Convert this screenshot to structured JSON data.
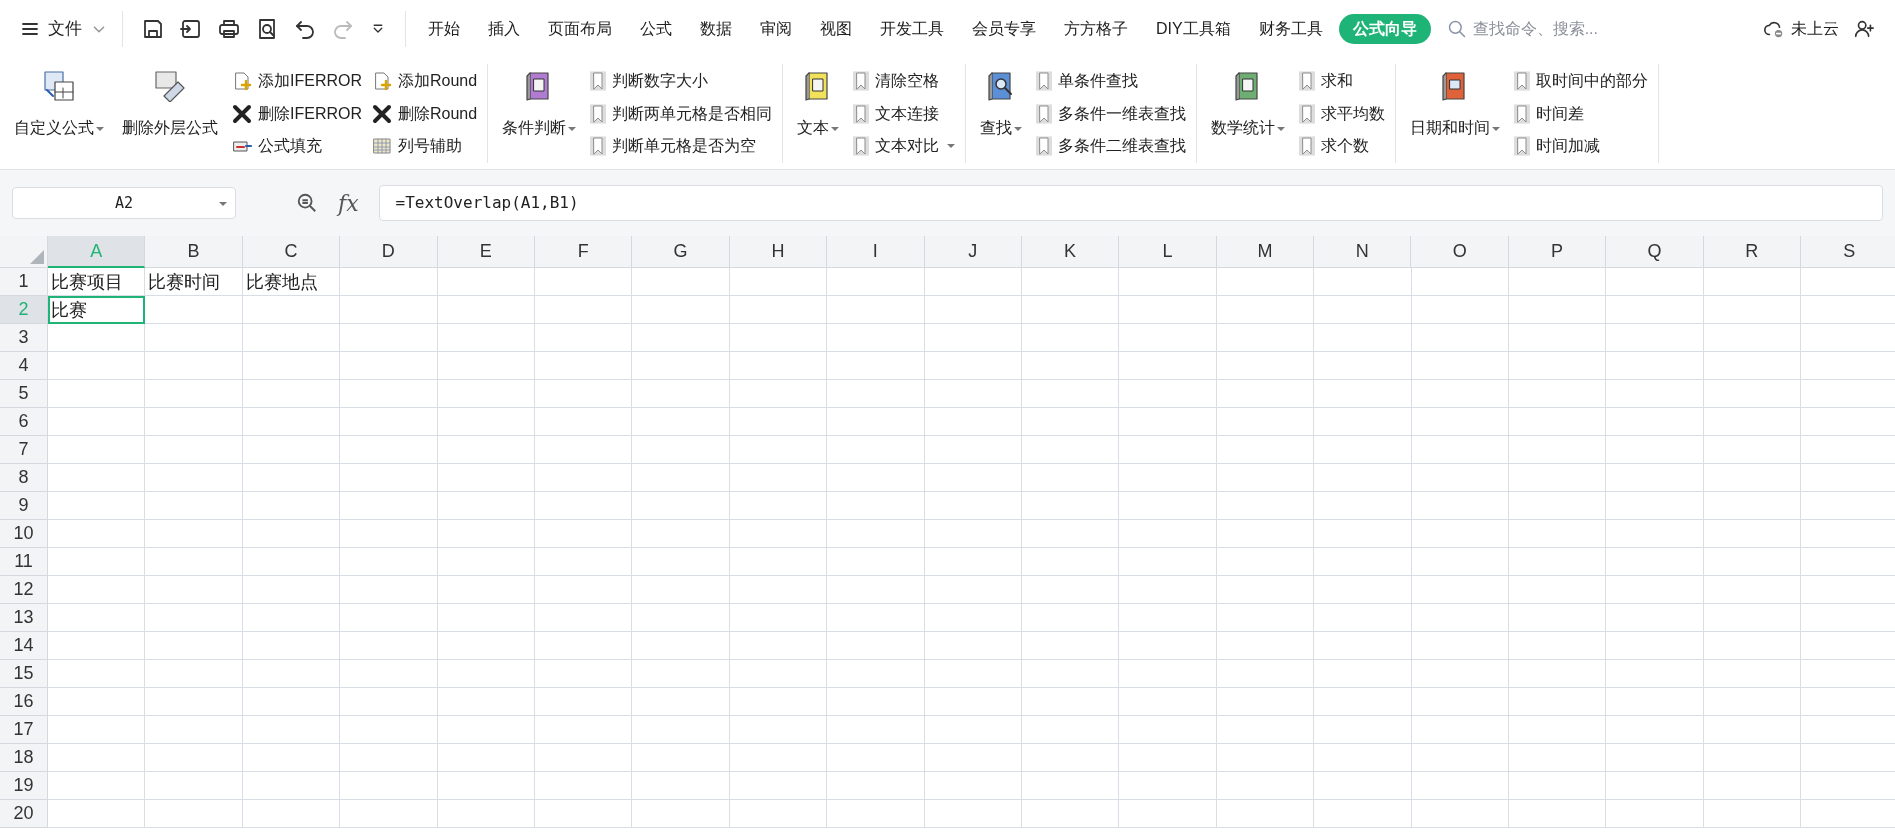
{
  "file_menu": {
    "label": "文件"
  },
  "tabs": [
    {
      "label": "开始",
      "selected": false
    },
    {
      "label": "插入",
      "selected": false
    },
    {
      "label": "页面布局",
      "selected": false
    },
    {
      "label": "公式",
      "selected": false
    },
    {
      "label": "数据",
      "selected": false
    },
    {
      "label": "审阅",
      "selected": false
    },
    {
      "label": "视图",
      "selected": false
    },
    {
      "label": "开发工具",
      "selected": false
    },
    {
      "label": "会员专享",
      "selected": false
    },
    {
      "label": "方方格子",
      "selected": false
    },
    {
      "label": "DIY工具箱",
      "selected": false
    },
    {
      "label": "财务工具",
      "selected": false
    },
    {
      "label": "公式向导",
      "selected": true
    }
  ],
  "search": {
    "placeholder": "查找命令、搜索..."
  },
  "cloud_status": "未上云",
  "ribbon_groups": [
    {
      "large": [
        {
          "label": "自定义公式",
          "dropdown": true
        },
        {
          "label": "删除外层公式",
          "dropdown": false
        }
      ],
      "columns": [
        [
          {
            "label": "添加IFERROR",
            "dropdown": false
          },
          {
            "label": "删除IFERROR",
            "dropdown": false
          },
          {
            "label": "公式填充",
            "dropdown": false
          }
        ],
        [
          {
            "label": "添加Round",
            "dropdown": false
          },
          {
            "label": "删除Round",
            "dropdown": false
          },
          {
            "label": "列号辅助",
            "dropdown": false
          }
        ]
      ]
    },
    {
      "large": [
        {
          "label": "条件判断",
          "dropdown": true
        }
      ],
      "columns": [
        [
          {
            "label": "判断数字大小",
            "dropdown": false
          },
          {
            "label": "判断两单元格是否相同",
            "dropdown": false
          },
          {
            "label": "判断单元格是否为空",
            "dropdown": false
          }
        ]
      ]
    },
    {
      "large": [
        {
          "label": "文本",
          "dropdown": true
        }
      ],
      "columns": [
        [
          {
            "label": "清除空格",
            "dropdown": false
          },
          {
            "label": "文本连接",
            "dropdown": false
          },
          {
            "label": "文本对比",
            "dropdown": true
          }
        ]
      ]
    },
    {
      "large": [
        {
          "label": "查找",
          "dropdown": true
        }
      ],
      "columns": [
        [
          {
            "label": "单条件查找",
            "dropdown": false
          },
          {
            "label": "多条件一维表查找",
            "dropdown": false
          },
          {
            "label": "多条件二维表查找",
            "dropdown": false
          }
        ]
      ]
    },
    {
      "large": [
        {
          "label": "数学统计",
          "dropdown": true
        }
      ],
      "columns": [
        [
          {
            "label": "求和",
            "dropdown": false
          },
          {
            "label": "求平均数",
            "dropdown": false
          },
          {
            "label": "求个数",
            "dropdown": false
          }
        ]
      ]
    },
    {
      "large": [
        {
          "label": "日期和时间",
          "dropdown": true
        }
      ],
      "columns": [
        [
          {
            "label": "取时间中的部分",
            "dropdown": false
          },
          {
            "label": "时间差",
            "dropdown": false
          },
          {
            "label": "时间加减",
            "dropdown": false
          }
        ]
      ]
    }
  ],
  "formula_bar": {
    "name_box": "A2",
    "fx_label": "fx",
    "formula": "=TextOverlap(A1,B1)"
  },
  "sheet": {
    "columns": [
      {
        "label": "A",
        "selected": true
      },
      {
        "label": "B",
        "selected": false
      },
      {
        "label": "C",
        "selected": false
      },
      {
        "label": "D",
        "selected": false
      },
      {
        "label": "E",
        "selected": false
      },
      {
        "label": "F",
        "selected": false
      },
      {
        "label": "G",
        "selected": false
      },
      {
        "label": "H",
        "selected": false
      },
      {
        "label": "I",
        "selected": false
      },
      {
        "label": "J",
        "selected": false
      },
      {
        "label": "K",
        "selected": false
      },
      {
        "label": "L",
        "selected": false
      },
      {
        "label": "M",
        "selected": false
      },
      {
        "label": "N",
        "selected": false
      },
      {
        "label": "O",
        "selected": false
      },
      {
        "label": "P",
        "selected": false
      },
      {
        "label": "Q",
        "selected": false
      },
      {
        "label": "R",
        "selected": false
      },
      {
        "label": "S",
        "selected": false
      }
    ],
    "rows": [
      {
        "label": "1",
        "selected": false,
        "cells": [
          "比赛项目",
          "比赛时间",
          "比赛地点"
        ]
      },
      {
        "label": "2",
        "selected": true,
        "cells": [
          "比赛"
        ]
      },
      {
        "label": "3",
        "selected": false
      },
      {
        "label": "4",
        "selected": false
      },
      {
        "label": "5",
        "selected": false
      },
      {
        "label": "6",
        "selected": false
      },
      {
        "label": "7",
        "selected": false
      },
      {
        "label": "8",
        "selected": false
      },
      {
        "label": "9",
        "selected": false
      },
      {
        "label": "10",
        "selected": false
      },
      {
        "label": "11",
        "selected": false
      },
      {
        "label": "12",
        "selected": false
      },
      {
        "label": "13",
        "selected": false
      },
      {
        "label": "14",
        "selected": false
      },
      {
        "label": "15",
        "selected": false
      },
      {
        "label": "16",
        "selected": false
      },
      {
        "label": "17",
        "selected": false
      },
      {
        "label": "18",
        "selected": false
      },
      {
        "label": "19",
        "selected": false
      },
      {
        "label": "20",
        "selected": false
      }
    ]
  }
}
